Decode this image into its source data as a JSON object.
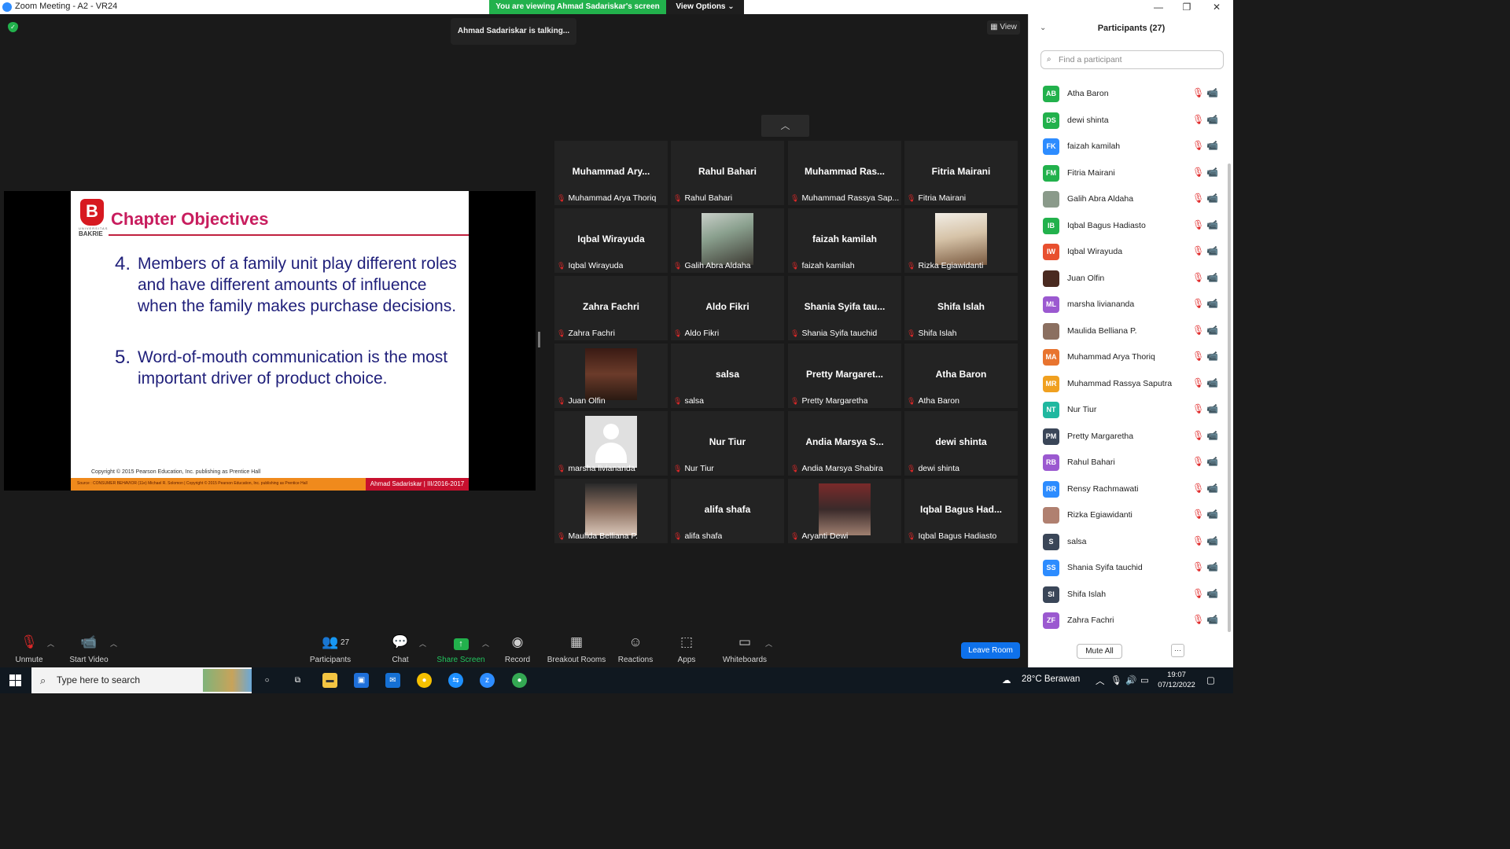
{
  "window": {
    "title": "Zoom Meeting - A2 - VR24",
    "viewing_banner": "You are viewing Ahmad Sadariskar's screen",
    "view_options": "View Options ⌄",
    "min": "—",
    "max": "❐",
    "close": "✕"
  },
  "meeting": {
    "talking": "Ahmad Sadariskar is talking...",
    "view_label": "View"
  },
  "slide": {
    "logo_letter": "B",
    "logo_text_small": "UNIVERSITAS",
    "logo_text": "BAKRIE",
    "title": "Chapter Objectives",
    "objectives": [
      {
        "num": "4.",
        "text": "Members of a family unit play different roles and have different amounts of influence when the family makes purchase decisions."
      },
      {
        "num": "5.",
        "text": "Word-of-mouth communication is the most important driver of product choice."
      }
    ],
    "copyright": "Copyright © 2015 Pearson Education, Inc. publishing as Prentice Hall",
    "source": "Source : CONSUMER BEHAVIOR (11e) Michael R. Solomon | Copyright © 2015 Pearson Education, Inc. publishing as Prentice Hall",
    "author": "Ahmad Sadariskar | III/2016-2017"
  },
  "gallery": {
    "tiles": [
      {
        "name": "Muhammad Ary...",
        "label": "Muhammad Arya Thoriq"
      },
      {
        "name": "Rahul Bahari",
        "label": "Rahul Bahari"
      },
      {
        "name": "Muhammad Ras...",
        "label": "Muhammad Rassya Sap..."
      },
      {
        "name": "Fitria Mairani",
        "label": "Fitria Mairani"
      },
      {
        "name": "Iqbal Wirayuda",
        "label": "Iqbal Wirayuda"
      },
      {
        "name": "",
        "label": "Galih Abra Aldaha"
      },
      {
        "name": "faizah kamilah",
        "label": "faizah kamilah"
      },
      {
        "name": "",
        "label": "Rizka Egiawidanti"
      },
      {
        "name": "Zahra Fachri",
        "label": "Zahra Fachri"
      },
      {
        "name": "Aldo Fikri",
        "label": "Aldo Fikri"
      },
      {
        "name": "Shania Syifa tau...",
        "label": "Shania Syifa tauchid"
      },
      {
        "name": "Shifa Islah",
        "label": "Shifa Islah"
      },
      {
        "name": "",
        "label": "Juan Olfin"
      },
      {
        "name": "salsa",
        "label": "salsa"
      },
      {
        "name": "Pretty Margaret...",
        "label": "Pretty Margaretha"
      },
      {
        "name": "Atha Baron",
        "label": "Atha Baron"
      },
      {
        "name": "",
        "label": "marsha livianandа"
      },
      {
        "name": "Nur Tiur",
        "label": "Nur Tiur"
      },
      {
        "name": "Andia Marsya S...",
        "label": "Andia Marsya Shabira"
      },
      {
        "name": "dewi shinta",
        "label": "dewi shinta"
      },
      {
        "name": "",
        "label": "Maulida Belliana P."
      },
      {
        "name": "alifa shafa",
        "label": "alifa shafa"
      },
      {
        "name": "",
        "label": "Aryanti Dewi"
      },
      {
        "name": "Iqbal Bagus Had...",
        "label": "Iqbal Bagus Hadiasto"
      }
    ]
  },
  "toolbar": {
    "unmute": "Unmute",
    "start_video": "Start Video",
    "participants": "Participants",
    "participants_count": "27",
    "chat": "Chat",
    "share_screen": "Share Screen",
    "record": "Record",
    "breakout": "Breakout Rooms",
    "reactions": "Reactions",
    "apps": "Apps",
    "whiteboards": "Whiteboards",
    "leave": "Leave Room"
  },
  "panel": {
    "title": "Participants (27)",
    "search_placeholder": "Find a participant",
    "participants": [
      {
        "initials": "AB",
        "name": "Atha Baron",
        "color": "#22b14c"
      },
      {
        "initials": "DS",
        "name": "dewi shinta",
        "color": "#22b14c"
      },
      {
        "initials": "FK",
        "name": "faizah kamilah",
        "color": "#2d8cff"
      },
      {
        "initials": "FM",
        "name": "Fitria Mairani",
        "color": "#22b14c"
      },
      {
        "initials": "",
        "name": "Galih Abra Aldaha",
        "color": "#8a9a8a"
      },
      {
        "initials": "IB",
        "name": "Iqbal Bagus Hadiasto",
        "color": "#22b14c"
      },
      {
        "initials": "IW",
        "name": "Iqbal Wirayuda",
        "color": "#e8502f"
      },
      {
        "initials": "",
        "name": "Juan Olfin",
        "color": "#4a2a20"
      },
      {
        "initials": "ML",
        "name": "marsha livianandа",
        "color": "#9b59d0"
      },
      {
        "initials": "",
        "name": "Maulida Belliana P.",
        "color": "#8b6f60"
      },
      {
        "initials": "MA",
        "name": "Muhammad Arya Thoriq",
        "color": "#e8742f"
      },
      {
        "initials": "MR",
        "name": "Muhammad Rassya Saputra",
        "color": "#f0a020"
      },
      {
        "initials": "NT",
        "name": "Nur Tiur",
        "color": "#20b8a0"
      },
      {
        "initials": "PM",
        "name": "Pretty Margaretha",
        "color": "#3a4658"
      },
      {
        "initials": "RB",
        "name": "Rahul Bahari",
        "color": "#9b59d0"
      },
      {
        "initials": "RR",
        "name": "Rensy Rachmawati",
        "color": "#2d8cff"
      },
      {
        "initials": "",
        "name": "Rizka Egiawidanti",
        "color": "#b08070"
      },
      {
        "initials": "S",
        "name": "salsa",
        "color": "#3a4658"
      },
      {
        "initials": "SS",
        "name": "Shania Syifa tauchid",
        "color": "#2d8cff"
      },
      {
        "initials": "SI",
        "name": "Shifa Islah",
        "color": "#3a4658"
      },
      {
        "initials": "ZF",
        "name": "Zahra Fachri",
        "color": "#9b59d0"
      }
    ],
    "mute_all": "Mute All",
    "more": "···"
  },
  "taskbar": {
    "search_placeholder": "Type here to search",
    "weather": "28°C  Berawan",
    "time": "19:07",
    "date": "07/12/2022"
  }
}
